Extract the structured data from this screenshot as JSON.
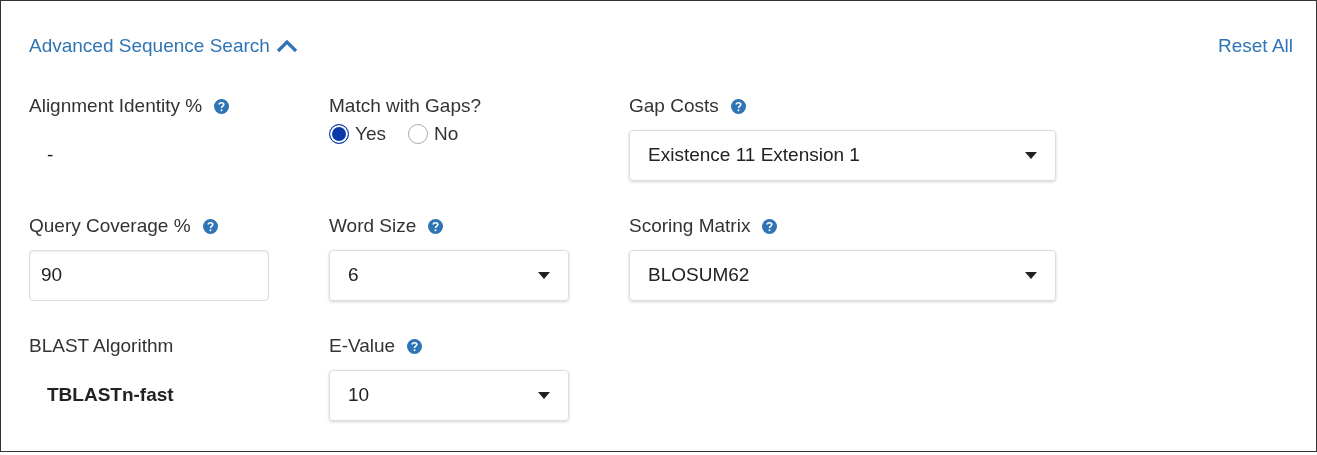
{
  "header": {
    "title": "Advanced Sequence Search",
    "expanded": true,
    "reset": "Reset All"
  },
  "fields": [
    {
      "kind": "static",
      "label": "Alignment Identity %",
      "help": true,
      "value": "-"
    },
    {
      "kind": "radio",
      "label": "Match with Gaps?",
      "help": false,
      "options": [
        {
          "label": "Yes",
          "selected": true
        },
        {
          "label": "No",
          "selected": false
        }
      ]
    },
    {
      "kind": "select",
      "label": "Gap Costs",
      "help": true,
      "value": "Existence 11 Extension 1",
      "wide": true
    },
    {
      "kind": "input",
      "label": "Query Coverage %",
      "help": true,
      "value": "90"
    },
    {
      "kind": "select",
      "label": "Word Size",
      "help": true,
      "value": "6",
      "wide": false
    },
    {
      "kind": "select",
      "label": "Scoring Matrix",
      "help": true,
      "value": "BLOSUM62",
      "wide": true
    },
    {
      "kind": "static",
      "label": "BLAST Algorithm",
      "help": false,
      "value": "TBLASTn-fast",
      "bold": true
    },
    {
      "kind": "select",
      "label": "E-Value",
      "help": true,
      "value": "10",
      "wide": false
    }
  ]
}
